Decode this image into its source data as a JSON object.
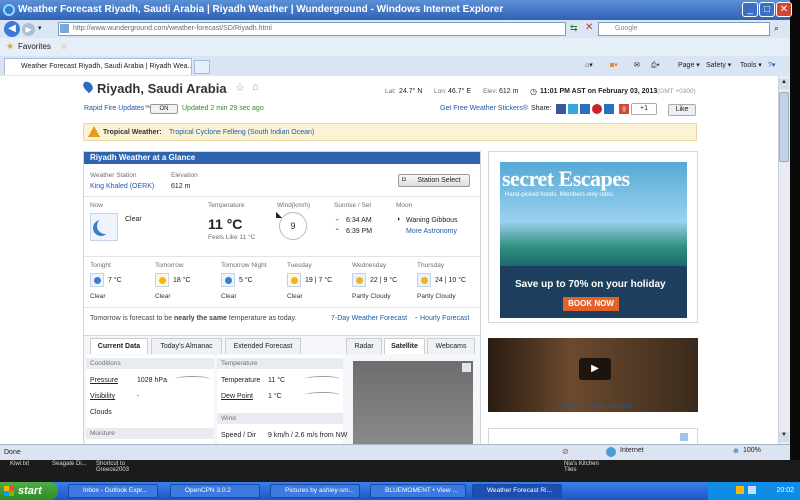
{
  "window": {
    "title": "Weather Forecast Riyadh, Saudi Arabia | Riyadh Weather | Wunderground - Windows Internet Explorer",
    "min": "_",
    "max": "□",
    "close": "✕"
  },
  "browser": {
    "url": "http://www.wunderground.com/weather-forecast/SD/Riyadh.html",
    "search_placeholder": "Google",
    "favorites": "Favorites",
    "tab_title": "Weather Forecast Riyadh, Saudi Arabia | Riyadh Wea...",
    "page_menu": "Page ▾",
    "safety_menu": "Safety ▾",
    "tools_menu": "Tools ▾"
  },
  "header": {
    "city": "Riyadh, Saudi Arabia",
    "lat_label": "Lat:",
    "lat": "24.7° N",
    "lon_label": "Lon:",
    "lon": "46.7° E",
    "elev_label": "Elev:",
    "elev": "612 m",
    "time": "11:01 PM AST on February 03, 2013",
    "tz": "(GMT +0300)"
  },
  "rapid": {
    "label": "Rapid Fire Updates™",
    "state": "ON",
    "updated": "Updated 2 min 29 sec ago",
    "stickers": "Get Free Weather Stickers®",
    "share": "Share:",
    "like": "Like",
    "plus": "+1"
  },
  "alert": {
    "label": "Tropical Weather:",
    "text": "Tropical Cyclone Felleng (South Indian Ocean)"
  },
  "glance": {
    "title": "Riyadh Weather at a Glance",
    "station_label": "Weather Station",
    "station": "King Khaled (OERK)",
    "elev_label": "Elevation",
    "elev": "612 m",
    "station_btn": "Station Select"
  },
  "now": {
    "label": "Now",
    "condition": "Clear",
    "temp_label": "Temperature",
    "temp": "11 °C",
    "feels": "Feels Like 11 °C",
    "wind_label": "Wind(km/h)",
    "wind": "9",
    "sun_label": "Sunrise / Set",
    "sunrise": "6:34 AM",
    "sunset": "6:39 PM",
    "moon_label": "Moon",
    "moon": "Waning Gibbous",
    "more": "More Astronomy"
  },
  "forecast": [
    {
      "day": "Tonight",
      "temp": "7 °C",
      "cond": "Clear"
    },
    {
      "day": "Tomorrow",
      "temp": "18 °C",
      "cond": "Clear"
    },
    {
      "day": "Tomorrow Night",
      "temp": "5 °C",
      "cond": "Clear"
    },
    {
      "day": "Tuesday",
      "temp": "19 | 7 °C",
      "cond": "Clear"
    },
    {
      "day": "Wednesday",
      "temp": "22 | 9 °C",
      "cond": "Partly Cloudy"
    },
    {
      "day": "Thursday",
      "temp": "24 | 10 °C",
      "cond": "Partly Cloudy"
    }
  ],
  "compare": {
    "pre": "Tomorrow is forecast to be ",
    "bold": "nearly the same",
    "post": " temperature as today.",
    "link7": "7-Day Weather Forecast",
    "sep": " - ",
    "hourly": "Hourly Forecast"
  },
  "tabs": [
    "Current Data",
    "Today's Almanac",
    "Extended Forecast",
    "Radar",
    "Satellite",
    "Webcams"
  ],
  "current": {
    "conditions": "Conditions",
    "pressure_l": "Pressure",
    "pressure": "1028 hPa",
    "visibility_l": "Visibility",
    "visibility": "-",
    "clouds_l": "Clouds",
    "moisture": "Moisture",
    "temperature": "Temperature",
    "temp_l": "Temperature",
    "temp": "11 °C",
    "dew_l": "Dew Point",
    "dew": "1 °C",
    "wind": "Wind",
    "speed_l": "Speed / Dir",
    "speed": "9 km/h / 2.6 m/s from NW"
  },
  "ad": {
    "brand": "secret Escapes",
    "tagline": "Hand-picked hotels. Members-only rates.",
    "save": "Save up to 70% on your holiday",
    "book": "BOOK NOW"
  },
  "video": {
    "link": "Visit Our Video Section"
  },
  "statusbar": {
    "left": "Done",
    "zone": "Internet",
    "zoom": "100%"
  },
  "desktop": {
    "i1": "Kiwi.txt",
    "i2": "Seagate Di...",
    "i3": "Shortcut to Greece2003",
    "i4": "Nia's Kitchen Tiles"
  },
  "taskbar": {
    "start": "start",
    "t1": "Inbox - Outlook Expr...",
    "t2": "OpenCPN 3.0.2",
    "t3": "Pictures by ashley-sm...",
    "t4": "BLUEMOMENT • View ...",
    "t5": "Weather Forecast Ri...",
    "clock": "20:02"
  }
}
